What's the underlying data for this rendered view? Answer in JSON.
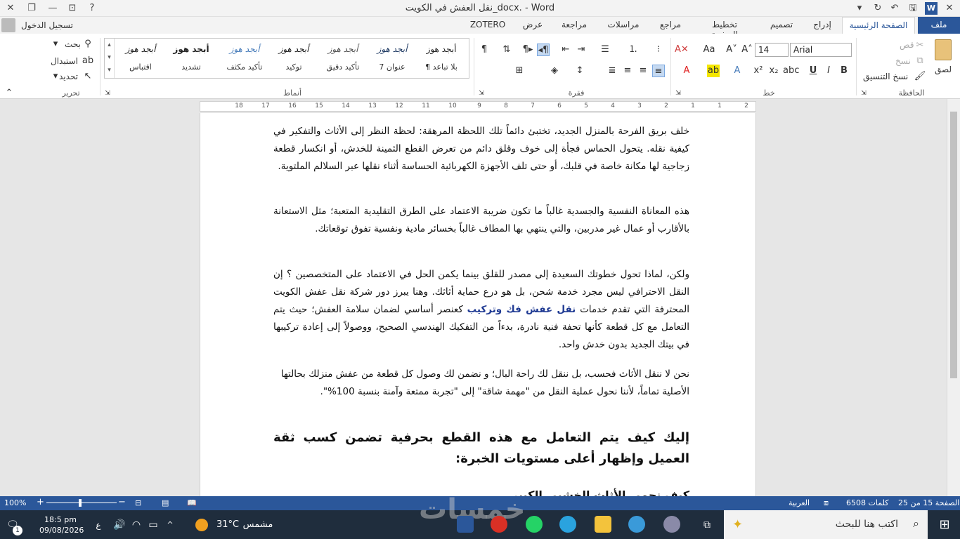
{
  "window": {
    "title": "نقل العفش في الكويت_docx. - Word",
    "controls": [
      "close-icon",
      "restore-icon",
      "minimize-icon",
      "ribbon-display-icon",
      "help-icon"
    ]
  },
  "quick_access": {
    "icons": [
      "save-icon",
      "undo-icon",
      "redo-icon",
      "customize-icon"
    ]
  },
  "signin": {
    "label": "تسجيل الدخول"
  },
  "tabs": [
    {
      "label": "ملف"
    },
    {
      "label": "الصفحة الرئيسية"
    },
    {
      "label": "إدراج"
    },
    {
      "label": "تصميم"
    },
    {
      "label": "تخطيط الصفحة"
    },
    {
      "label": "مراجع"
    },
    {
      "label": "مراسلات"
    },
    {
      "label": "مراجعة"
    },
    {
      "label": "عرض"
    },
    {
      "label": "ZOTERO"
    }
  ],
  "ribbon": {
    "clipboard": {
      "group_label": "الحافظة",
      "paste": "لصق",
      "cut": "قص",
      "copy": "نسخ",
      "format_painter": "نسخ التنسيق"
    },
    "font": {
      "group_label": "خط",
      "font_name": "Arial",
      "font_size": "14"
    },
    "paragraph": {
      "group_label": "فقرة"
    },
    "styles": {
      "group_label": "أنماط",
      "items": [
        {
          "sample": "أبجد هوز",
          "name": "¶ بلا تباعد"
        },
        {
          "sample": "أبجد هوز",
          "name": "عنوان 7"
        },
        {
          "sample": "أبجد هوز",
          "name": "تأكيد دقيق"
        },
        {
          "sample": "أبجد هوز",
          "name": "توكيد"
        },
        {
          "sample": "أبجد هوز",
          "name": "تأكيد مكثف"
        },
        {
          "sample": "أبجد هوز",
          "name": "تشديد"
        },
        {
          "sample": "أبجد هوز",
          "name": "اقتباس"
        }
      ]
    },
    "editing": {
      "group_label": "تحرير",
      "find": "بحث",
      "replace": "استبدال",
      "select": "تحديد"
    }
  },
  "ruler": {
    "ticks": [
      "2",
      "1",
      "1",
      "2",
      "3",
      "4",
      "5",
      "6",
      "7",
      "8",
      "9",
      "10",
      "11",
      "12",
      "13",
      "14",
      "15",
      "16",
      "17",
      "18"
    ]
  },
  "document": {
    "p1": "خلف بريق الفرحة بالمنزل الجديد، تختبئ دائماً تلك اللحظة المرهقة: لحظة النظر إلى الأثاث والتفكير في كيفية نقله. يتحول الحماس فجأة إلى خوف وقلق دائم من تعرض القطع الثمينة للخدش، أو انكسار قطعة زجاجية لها مكانة خاصة في قلبك، أو حتى تلف الأجهزة الكهربائية الحساسة أثناء نقلها عبر السلالم الملتوية.",
    "p2": "هذه المعاناة النفسية والجسدية غالباً ما تكون ضريبة الاعتماد على الطرق التقليدية المتعبة؛ مثل الاستعانة بالأقارب أو عمال غير مدربين، والتي ينتهي بها المطاف غالباً بخسائر مادية ونفسية تفوق توقعاتك.",
    "p3_intro": "ولكن، لماذا تحول خطوتك السعيدة إلى مصدر للقلق بينما يكمن الحل في الاعتماد على المتخصصين ؟ إن النقل الاحترافي ليس مجرد خدمة شحن، بل هو درع حماية أثاثك. وهنا يبرز دور شركة نقل عفش الكويت المحترفة التي تقدم خدمات ",
    "p3_link": "نقل عفش فك وتركيب",
    "p3_rest": " كعنصر أساسي لضمان سلامة العفش؛ حيث يتم التعامل مع كل قطعة كأنها تحفة فنية نادرة، بدءاً من التفكيك الهندسي الصحيح، ووصولاً إلى إعادة تركيبها في بيتك الجديد بدون خدش واحد.",
    "p4": "نحن لا ننقل الأثاث فحسب، بل ننقل لك راحة البال؛ و نضمن لك وصول كل قطعة من عفش منزلك بحالتها الأصلية تماماً، لأننا نحول عملية النقل من \"مهمة شاقة\" إلى \"تجربة ممتعة وآمنة بنسبة 100%\".",
    "heading": "إليك كيف يتم التعامل مع هذه القطع بحرفية تضمن كسب ثقة العميل وإظهار أعلى مستويات الخبرة:",
    "cut_line": "كيف نحمي الأثاث الخشبي الكبير"
  },
  "status": {
    "page": "الصفحة 15 من 25",
    "words": "6508 كلمات",
    "language": "العربية",
    "zoom": "100%"
  },
  "taskbar": {
    "search_placeholder": "اكتب هنا للبحث",
    "weather_label": "مشمس",
    "temperature": "31°C",
    "time": "18:5 pm",
    "date": "09/08/2026",
    "lang": "ع",
    "notification_count": "1"
  },
  "watermark": {
    "text": "خمسات"
  },
  "colors": {
    "accent": "#2b579a",
    "link": "#1f3a93",
    "font_red": "#e02020",
    "highlight_yellow": "#f4e600"
  }
}
